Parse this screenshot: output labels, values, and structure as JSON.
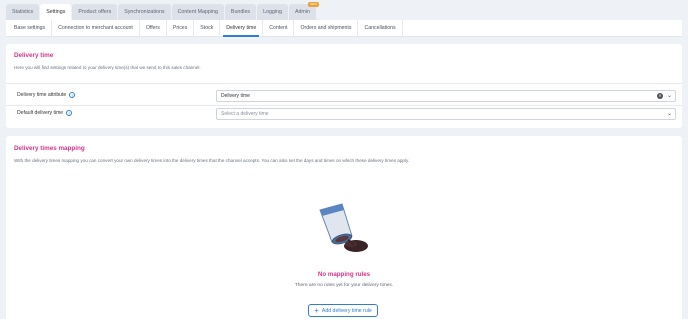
{
  "top_tabs": [
    {
      "label": "Statistics",
      "active": false
    },
    {
      "label": "Settings",
      "active": true
    },
    {
      "label": "Product offers",
      "active": false
    },
    {
      "label": "Synchronizations",
      "active": false
    },
    {
      "label": "Content Mapping",
      "active": false
    },
    {
      "label": "Bundles",
      "active": false
    },
    {
      "label": "Logging",
      "active": false
    },
    {
      "label": "Admin",
      "active": false,
      "badge": "NEW"
    }
  ],
  "sub_tabs": [
    {
      "label": "Base settings",
      "active": false
    },
    {
      "label": "Connection to merchant account",
      "active": false
    },
    {
      "label": "Offers",
      "active": false
    },
    {
      "label": "Prices",
      "active": false
    },
    {
      "label": "Stock",
      "active": false
    },
    {
      "label": "Delivery time",
      "active": true
    },
    {
      "label": "Content",
      "active": false
    },
    {
      "label": "Orders and shipments",
      "active": false
    },
    {
      "label": "Cancellations",
      "active": false
    }
  ],
  "delivery_time": {
    "title": "Delivery time",
    "description": "Here you will find settings related to your delivery time(s) that we send to this sales channel.",
    "attribute_label": "Delivery time attribute",
    "attribute_value": "Delivery time",
    "default_label": "Default delivery time",
    "default_placeholder": "Select a delivery time"
  },
  "mapping": {
    "title": "Delivery times mapping",
    "description": "With the delivery times mapping you can convert your own delivery times into the delivery times that the channel accepts. You can also set the days and times on which these delivery times apply.",
    "empty_title": "No mapping rules",
    "empty_description": "There are no rules yet for your delivery times.",
    "add_button": "Add delivery time rule"
  },
  "colors": {
    "accent": "#d6338a",
    "primary": "#2f7fd0",
    "badge": "#f0a030"
  }
}
